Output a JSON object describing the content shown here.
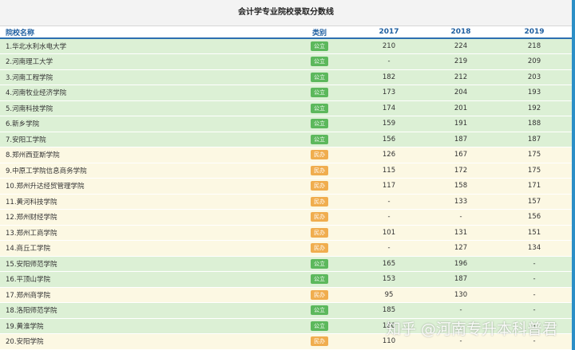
{
  "title": "会计学专业院校录取分数线",
  "headers": {
    "name": "院校名称",
    "type": "类别",
    "y2017": "2017",
    "y2018": "2018",
    "y2019": "2019"
  },
  "rows": [
    {
      "name": "1.华北水利水电大学",
      "type": "公立",
      "kind": "public",
      "y2017": "210",
      "y2018": "224",
      "y2019": "218"
    },
    {
      "name": "2.河南理工大学",
      "type": "公立",
      "kind": "public",
      "y2017": "-",
      "y2018": "219",
      "y2019": "209"
    },
    {
      "name": "3.河南工程学院",
      "type": "公立",
      "kind": "public",
      "y2017": "182",
      "y2018": "212",
      "y2019": "203"
    },
    {
      "name": "4.河南牧业经济学院",
      "type": "公立",
      "kind": "public",
      "y2017": "173",
      "y2018": "204",
      "y2019": "193"
    },
    {
      "name": "5.河南科技学院",
      "type": "公立",
      "kind": "public",
      "y2017": "174",
      "y2018": "201",
      "y2019": "192"
    },
    {
      "name": "6.新乡学院",
      "type": "公立",
      "kind": "public",
      "y2017": "159",
      "y2018": "191",
      "y2019": "188"
    },
    {
      "name": "7.安阳工学院",
      "type": "公立",
      "kind": "public",
      "y2017": "156",
      "y2018": "187",
      "y2019": "187"
    },
    {
      "name": "8.郑州西亚斯学院",
      "type": "民办",
      "kind": "private",
      "y2017": "126",
      "y2018": "167",
      "y2019": "175"
    },
    {
      "name": "9.中原工学院信息商务学院",
      "type": "民办",
      "kind": "private",
      "y2017": "115",
      "y2018": "172",
      "y2019": "175"
    },
    {
      "name": "10.郑州升达经贸管理学院",
      "type": "民办",
      "kind": "private",
      "y2017": "117",
      "y2018": "158",
      "y2019": "171"
    },
    {
      "name": "11.黄河科技学院",
      "type": "民办",
      "kind": "private",
      "y2017": "-",
      "y2018": "133",
      "y2019": "157"
    },
    {
      "name": "12.郑州财经学院",
      "type": "民办",
      "kind": "private",
      "y2017": "-",
      "y2018": "-",
      "y2019": "156"
    },
    {
      "name": "13.郑州工商学院",
      "type": "民办",
      "kind": "private",
      "y2017": "101",
      "y2018": "131",
      "y2019": "151"
    },
    {
      "name": "14.商丘工学院",
      "type": "民办",
      "kind": "private",
      "y2017": "-",
      "y2018": "127",
      "y2019": "134"
    },
    {
      "name": "15.安阳师范学院",
      "type": "公立",
      "kind": "public",
      "y2017": "165",
      "y2018": "196",
      "y2019": "-"
    },
    {
      "name": "16.平顶山学院",
      "type": "公立",
      "kind": "public",
      "y2017": "153",
      "y2018": "187",
      "y2019": "-"
    },
    {
      "name": "17.郑州商学院",
      "type": "民办",
      "kind": "private",
      "y2017": "95",
      "y2018": "130",
      "y2019": "-"
    },
    {
      "name": "18.洛阳师范学院",
      "type": "公立",
      "kind": "public",
      "y2017": "185",
      "y2018": "-",
      "y2019": "-"
    },
    {
      "name": "19.黄淮学院",
      "type": "公立",
      "kind": "public",
      "y2017": "180",
      "y2018": "-",
      "y2019": "-"
    },
    {
      "name": "20.安阳学院",
      "type": "民办",
      "kind": "private",
      "y2017": "110",
      "y2018": "-",
      "y2019": "-"
    }
  ],
  "watermark": "知乎 @河南专升本科普君",
  "colors": {
    "public_row": "#dcf0d5",
    "private_row": "#fcf8e3",
    "public_badge": "#5cb85c",
    "private_badge": "#f0ad4e",
    "header_text": "#1f5fa0",
    "frame": "#2c8fc7"
  }
}
